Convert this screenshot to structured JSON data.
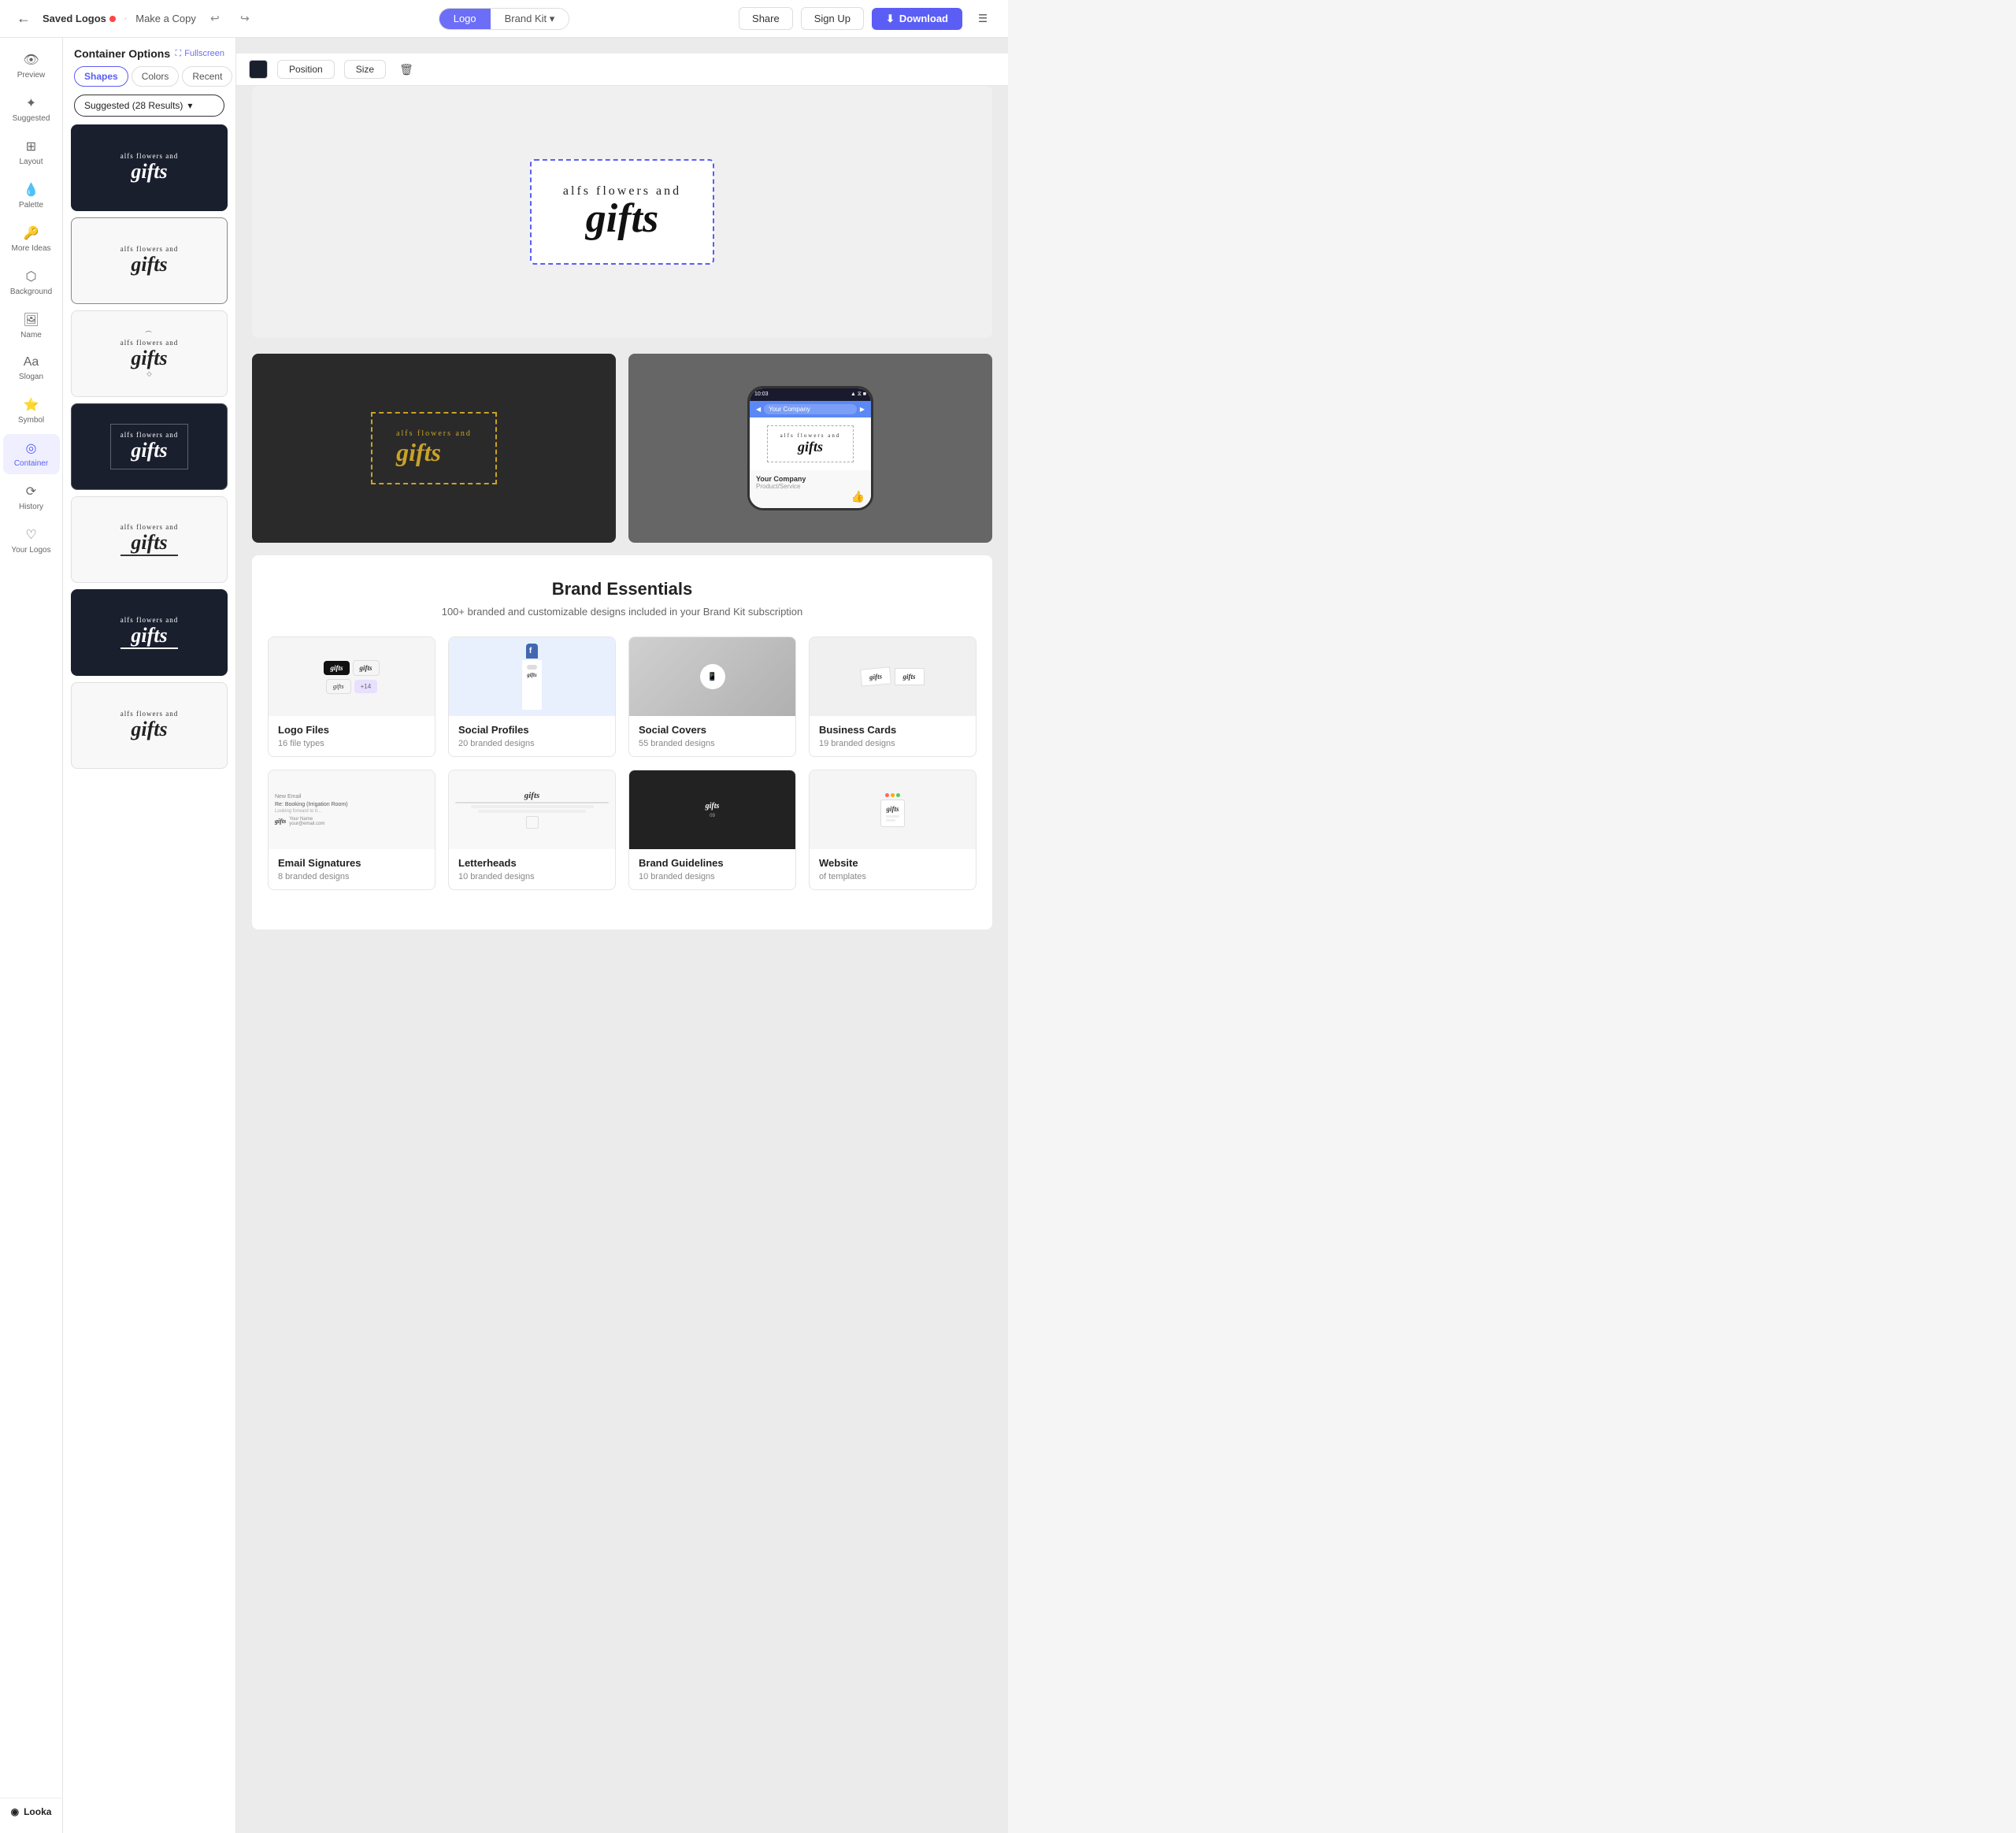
{
  "topbar": {
    "back_label": "←",
    "saved_logos_label": "Saved Logos",
    "make_copy_label": "Make a Copy",
    "undo_label": "↩",
    "redo_label": "↪",
    "logo_tab": "Logo",
    "brand_kit_tab": "Brand Kit",
    "share_label": "Share",
    "sign_in_label": "Sign Up",
    "download_label": "Download",
    "menu_label": "☰"
  },
  "sidebar": {
    "items": [
      {
        "id": "preview",
        "label": "Preview",
        "icon": "👁"
      },
      {
        "id": "suggested",
        "label": "Suggested",
        "icon": "✦"
      },
      {
        "id": "layout",
        "label": "Layout",
        "icon": "⊞"
      },
      {
        "id": "palette",
        "label": "Palette",
        "icon": "💧"
      },
      {
        "id": "more-ideas",
        "label": "More Ideas",
        "icon": "🔑"
      },
      {
        "id": "background",
        "label": "Background",
        "icon": "⬡"
      },
      {
        "id": "name",
        "label": "Name",
        "icon": "🖼"
      },
      {
        "id": "slogan",
        "label": "Slogan",
        "icon": "A̲"
      },
      {
        "id": "symbol",
        "label": "Symbol",
        "icon": "⭐"
      },
      {
        "id": "container",
        "label": "Container",
        "icon": "◎",
        "active": true
      },
      {
        "id": "history",
        "label": "History",
        "icon": "⟳"
      },
      {
        "id": "your-logos",
        "label": "Your Logos",
        "icon": "♡"
      }
    ]
  },
  "panel": {
    "title": "Container Options",
    "fullscreen_label": "Fullscreen",
    "tabs": [
      {
        "id": "shapes",
        "label": "Shapes",
        "active": true
      },
      {
        "id": "colors",
        "label": "Colors"
      },
      {
        "id": "recent",
        "label": "Recent"
      }
    ],
    "filter_label": "Suggested (28 Results)",
    "logo_name_small": "alfs flowers and",
    "logo_name_big": "gifts"
  },
  "toolbar": {
    "position_label": "Position",
    "size_label": "Size"
  },
  "canvas": {
    "preview_title": "alfs flowers and",
    "preview_main": "gifts",
    "mockup1": {
      "title": "alfs flowers and",
      "main": "gifts"
    },
    "mockup2": {
      "time": "10:03",
      "search": "Your Company",
      "title": "alfs flowers and",
      "main": "gifts",
      "company": "Your Company",
      "subtitle": "Product/Service"
    }
  },
  "brand_essentials": {
    "title": "Brand Essentials",
    "subtitle": "100+ branded and customizable designs included in your Brand Kit subscription",
    "cards": [
      {
        "id": "logo-files",
        "label": "Logo Files",
        "sub": "16 file types",
        "icon": "🗂"
      },
      {
        "id": "social-profiles",
        "label": "Social Profiles",
        "sub": "20 branded designs",
        "icon": "💬"
      },
      {
        "id": "social-covers",
        "label": "Social Covers",
        "sub": "55 branded designs",
        "icon": "📱"
      },
      {
        "id": "business-cards",
        "label": "Business Cards",
        "sub": "19 branded designs",
        "icon": "💼"
      },
      {
        "id": "email-signatures",
        "label": "Email Signatures",
        "sub": "8 branded designs",
        "icon": "✉"
      },
      {
        "id": "letterheads",
        "label": "Letterheads",
        "sub": "10 branded designs",
        "icon": "📋"
      },
      {
        "id": "brand-guidelines",
        "label": "Brand Guidelines",
        "sub": "10 branded designs",
        "icon": "📰"
      },
      {
        "id": "website",
        "label": "Website",
        "sub": "of templates",
        "icon": "🌐"
      }
    ]
  },
  "looka": {
    "brand_label": "Looka"
  }
}
